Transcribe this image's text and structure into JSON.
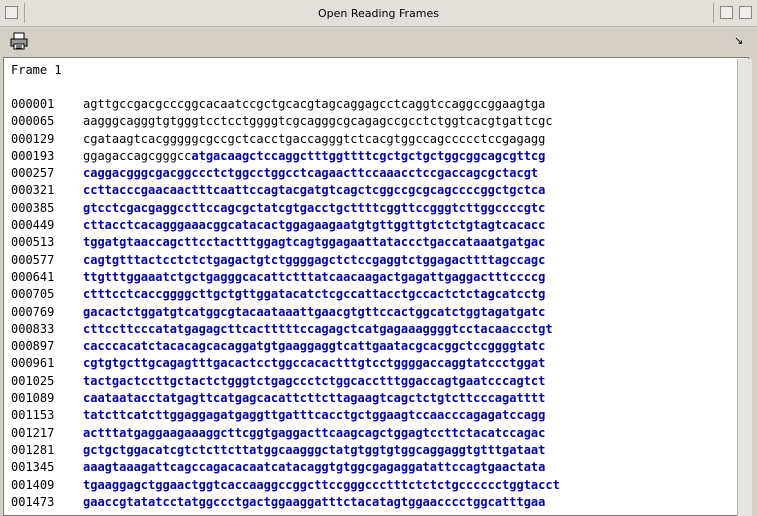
{
  "window": {
    "title": "Open Reading Frames"
  },
  "toolbar": {
    "print_icon": "printer-icon",
    "menu_icon": "corner-arrow-icon"
  },
  "frame": {
    "title": "Frame 1"
  },
  "rows": [
    {
      "num": "000001",
      "pre": "agttgccgacgcccggcacaatccgctgcacgtagcaggagcctcaggtccaggccggaagtga",
      "orf": ""
    },
    {
      "num": "000065",
      "pre": "aagggcagggtgtgggtcctcctggggtcgcagggcgcagagccgcctctggtcacgtgattcgc",
      "orf": ""
    },
    {
      "num": "000129",
      "pre": "cgataagtcacgggggcgccgctcacctgaccagggtctcacgtggccagccccctccgagagg",
      "orf": ""
    },
    {
      "num": "000193",
      "pre": "ggagaccagcgggcc",
      "orf": "atgacaagctccaggctttggttttcgctgctgctggcggcagcgttcg"
    },
    {
      "num": "000257",
      "pre": "",
      "orf": "caggacgggcgacggccctctggcctggcctcagaacttccaaacctccgaccagcgctacgt"
    },
    {
      "num": "000321",
      "pre": "",
      "orf": "ccttacccgaacaactttcaattccagtacgatgtcagctcggccgcgcagccccggctgctca"
    },
    {
      "num": "000385",
      "pre": "",
      "orf": "gtcctcgacgaggccttccagcgctatcgtgacctgcttttcggttccgggtcttggccccgtc"
    },
    {
      "num": "000449",
      "pre": "",
      "orf": "cttacctcacagggaaacggcatacactggagaagaatgtgttggttgtctctgtagtcacacc"
    },
    {
      "num": "000513",
      "pre": "",
      "orf": "tggatgtaaccagcttcctactttggagtcagtggagaattataccctgaccataaatgatgac"
    },
    {
      "num": "000577",
      "pre": "",
      "orf": "cagtgtttactcctctctgagactgtctggggagctctccgaggtctggagacttttagccagc"
    },
    {
      "num": "000641",
      "pre": "",
      "orf": "ttgtttggaaatctgctgagggcacattctttatcaacaagactgagattgaggactttccccg"
    },
    {
      "num": "000705",
      "pre": "",
      "orf": "ctttcctcaccggggcttgctgttggatacatctcgccattacctgccactctctagcatcctg"
    },
    {
      "num": "000769",
      "pre": "",
      "orf": "gacactctggatgtcatggcgtacaataaattgaacgtgttccactggcatctggtagatgatc"
    },
    {
      "num": "000833",
      "pre": "",
      "orf": "cttccttcccatatgagagcttcactttttccagagctcatgagaaaggggtcctacaaccctgt"
    },
    {
      "num": "000897",
      "pre": "",
      "orf": "cacccacatctacacagcacaggatgtgaaggaggtcattgaatacgcacggctccggggtatc"
    },
    {
      "num": "000961",
      "pre": "",
      "orf": "cgtgtgcttgcagagtttgacactcctggccacactttgtcctggggaccaggtatccctggat"
    },
    {
      "num": "001025",
      "pre": "",
      "orf": "tactgactccttgctactctgggtctgagccctctggcacctttggaccagtgaatcccagtct"
    },
    {
      "num": "001089",
      "pre": "",
      "orf": "caataatacctatgagttcatgagcacattcttcttagaagtcagctctgtcttcccagatttt"
    },
    {
      "num": "001153",
      "pre": "",
      "orf": "tatcttcatcttggaggagatgaggttgatttcacctgctggaagtccaacccagagatccagg"
    },
    {
      "num": "001217",
      "pre": "",
      "orf": "actttatgaggaagaaaggcttcggtgaggacttcaagcagctggagtccttctacatccagac"
    },
    {
      "num": "001281",
      "pre": "",
      "orf": "gctgctggacatcgtctcttcttatggcaagggctatgtggtgtggcaggaggtgtttgataat"
    },
    {
      "num": "001345",
      "pre": "",
      "orf": "aaagtaaagattcagccagacacaatcatacaggtgtggcgagaggatattccagtgaactata"
    },
    {
      "num": "001409",
      "pre": "",
      "orf": "tgaaggagctggaactggtcaccaaggccggcttccgggccctttctctctgcccccctggtacct"
    },
    {
      "num": "001473",
      "pre": "",
      "orf": "gaaccgtatatcctatggccctgactggaaggatttctacatagtggaacccctggcatttgaa"
    }
  ]
}
